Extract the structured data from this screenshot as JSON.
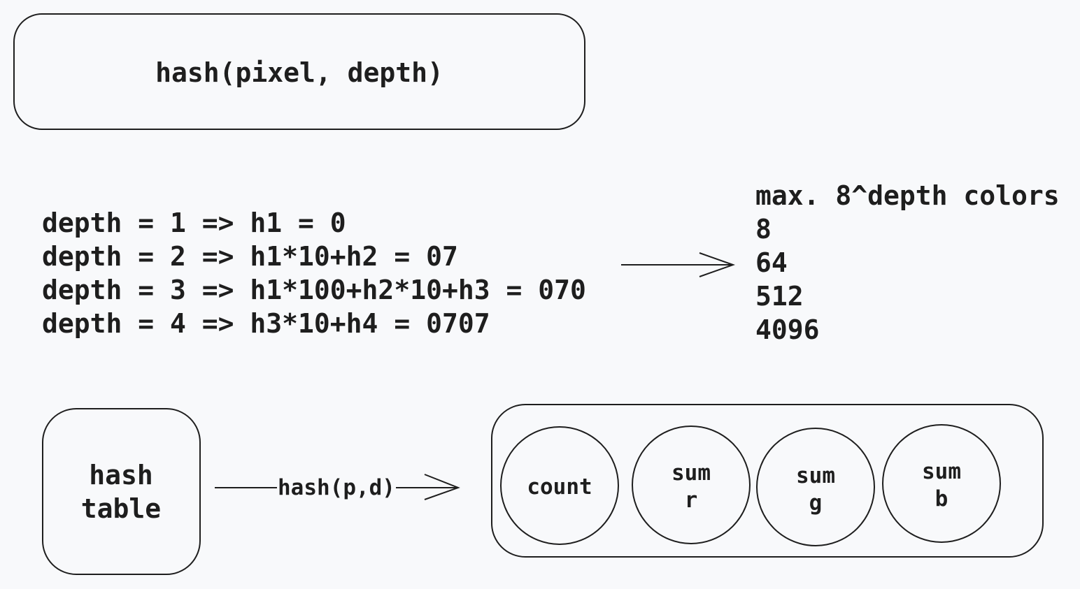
{
  "title_box": {
    "label": "hash(pixel, depth)"
  },
  "depth_lines": [
    "depth = 1 => h1 = 0",
    "depth = 2 => h1*10+h2 = 07",
    "depth = 3 => h1*100+h2*10+h3 = 070",
    "depth = 4 => h3*10+h4 = 0707"
  ],
  "colors_list": {
    "header": "max. 8^depth colors",
    "values": [
      "8",
      "64",
      "512",
      "4096"
    ]
  },
  "hash_table": {
    "line1": "hash",
    "line2": "table"
  },
  "arrow_label": "hash(p,d)",
  "entry_fields": [
    {
      "line1": "count",
      "line2": ""
    },
    {
      "line1": "sum",
      "line2": "r"
    },
    {
      "line1": "sum",
      "line2": "g"
    },
    {
      "line1": "sum",
      "line2": "b"
    }
  ],
  "colors": {
    "stroke": "#1e1e1e",
    "background": "#f8f9fb"
  }
}
